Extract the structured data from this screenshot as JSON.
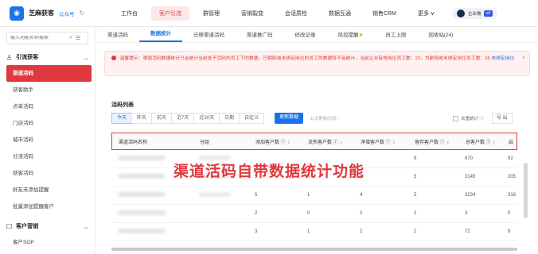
{
  "app": {
    "name": "芝麻获客",
    "public_account": "公众号",
    "refresh_icon": "refresh-icon"
  },
  "topnav": [
    {
      "label": "工作台"
    },
    {
      "label": "客户引流",
      "active": true
    },
    {
      "label": "群管理"
    },
    {
      "label": "营销裂变"
    },
    {
      "label": "会话质检"
    },
    {
      "label": "数据互通"
    },
    {
      "label": "销售CRM"
    },
    {
      "label": "更多 ∨"
    }
  ],
  "account": {
    "name": "企业微",
    "tag": "v4"
  },
  "sidebar": {
    "search_placeholder": "输入功能名称搜索",
    "groups": [
      {
        "label": "引流获客",
        "items": [
          {
            "label": "渠道活码",
            "active": true
          },
          {
            "label": "获客助手"
          },
          {
            "label": "点单活码"
          },
          {
            "label": "门店活码"
          },
          {
            "label": "城市活码"
          },
          {
            "label": "分流活码"
          },
          {
            "label": "获客活码"
          },
          {
            "label": "好友未添加提醒"
          },
          {
            "label": "批量添加提醒客户"
          }
        ]
      },
      {
        "label": "客户营销",
        "items": [
          {
            "label": "客户SOP"
          }
        ]
      }
    ]
  },
  "subtabs": [
    {
      "label": "渠道活码"
    },
    {
      "label": "数据统计",
      "active": true
    },
    {
      "label": "迁移渠道活码"
    },
    {
      "label": "渠道推广码"
    },
    {
      "label": "修改记录"
    },
    {
      "label": "风控提醒",
      "emoji": "★"
    },
    {
      "label": "员工上限"
    },
    {
      "label": "回收站(24)"
    }
  ],
  "notice": {
    "text": "温馨提示：渠道活码数据统计只会统计当前处于活码的员工下的数据，已剔除或未绑定岗位的员工的数据将不会统计。当前企业有效岗位员工数：23，为剔除或未绑定岗位员工数：26",
    "link": "去绑定岗位"
  },
  "list": {
    "title": "活码列表",
    "filters": [
      "今天",
      "昨天",
      "前天",
      "近7天",
      "近30天",
      "日期",
      "自定义"
    ],
    "active_filter": 0,
    "update_button": "更新数据",
    "last_update": "上次更新时间：",
    "dedupe_label": "去重统计 ⓘ",
    "export_button": "导 出",
    "columns": [
      "渠道活码名称",
      "分组",
      "添加客户数 ⓘ",
      "流失客户数 ⓘ",
      "净增客户数 ⓘ",
      "留存客户数 ⓘ",
      "总客户数 ⓘ",
      "启"
    ],
    "rows": [
      {
        "group": "",
        "added": "",
        "lost": "",
        "net": "",
        "kept": "8",
        "total": "670",
        "extra": "92"
      },
      {
        "group": "",
        "added": "5",
        "lost": "0",
        "net": "5",
        "kept": "5",
        "total": "3145",
        "extra": "205"
      },
      {
        "group": "",
        "added": "5",
        "lost": "1",
        "net": "4",
        "kept": "5",
        "total": "3234",
        "extra": "318"
      },
      {
        "group": "",
        "added": "2",
        "lost": "0",
        "net": "2",
        "kept": "2",
        "total": "3",
        "extra": "0"
      },
      {
        "group": "",
        "added": "3",
        "lost": "1",
        "net": "2",
        "kept": "2",
        "total": "72",
        "extra": "9"
      }
    ]
  },
  "caption": "渠道活码自带数据统计功能",
  "colors": {
    "accent": "#e0383e",
    "primary": "#1a73e8"
  }
}
